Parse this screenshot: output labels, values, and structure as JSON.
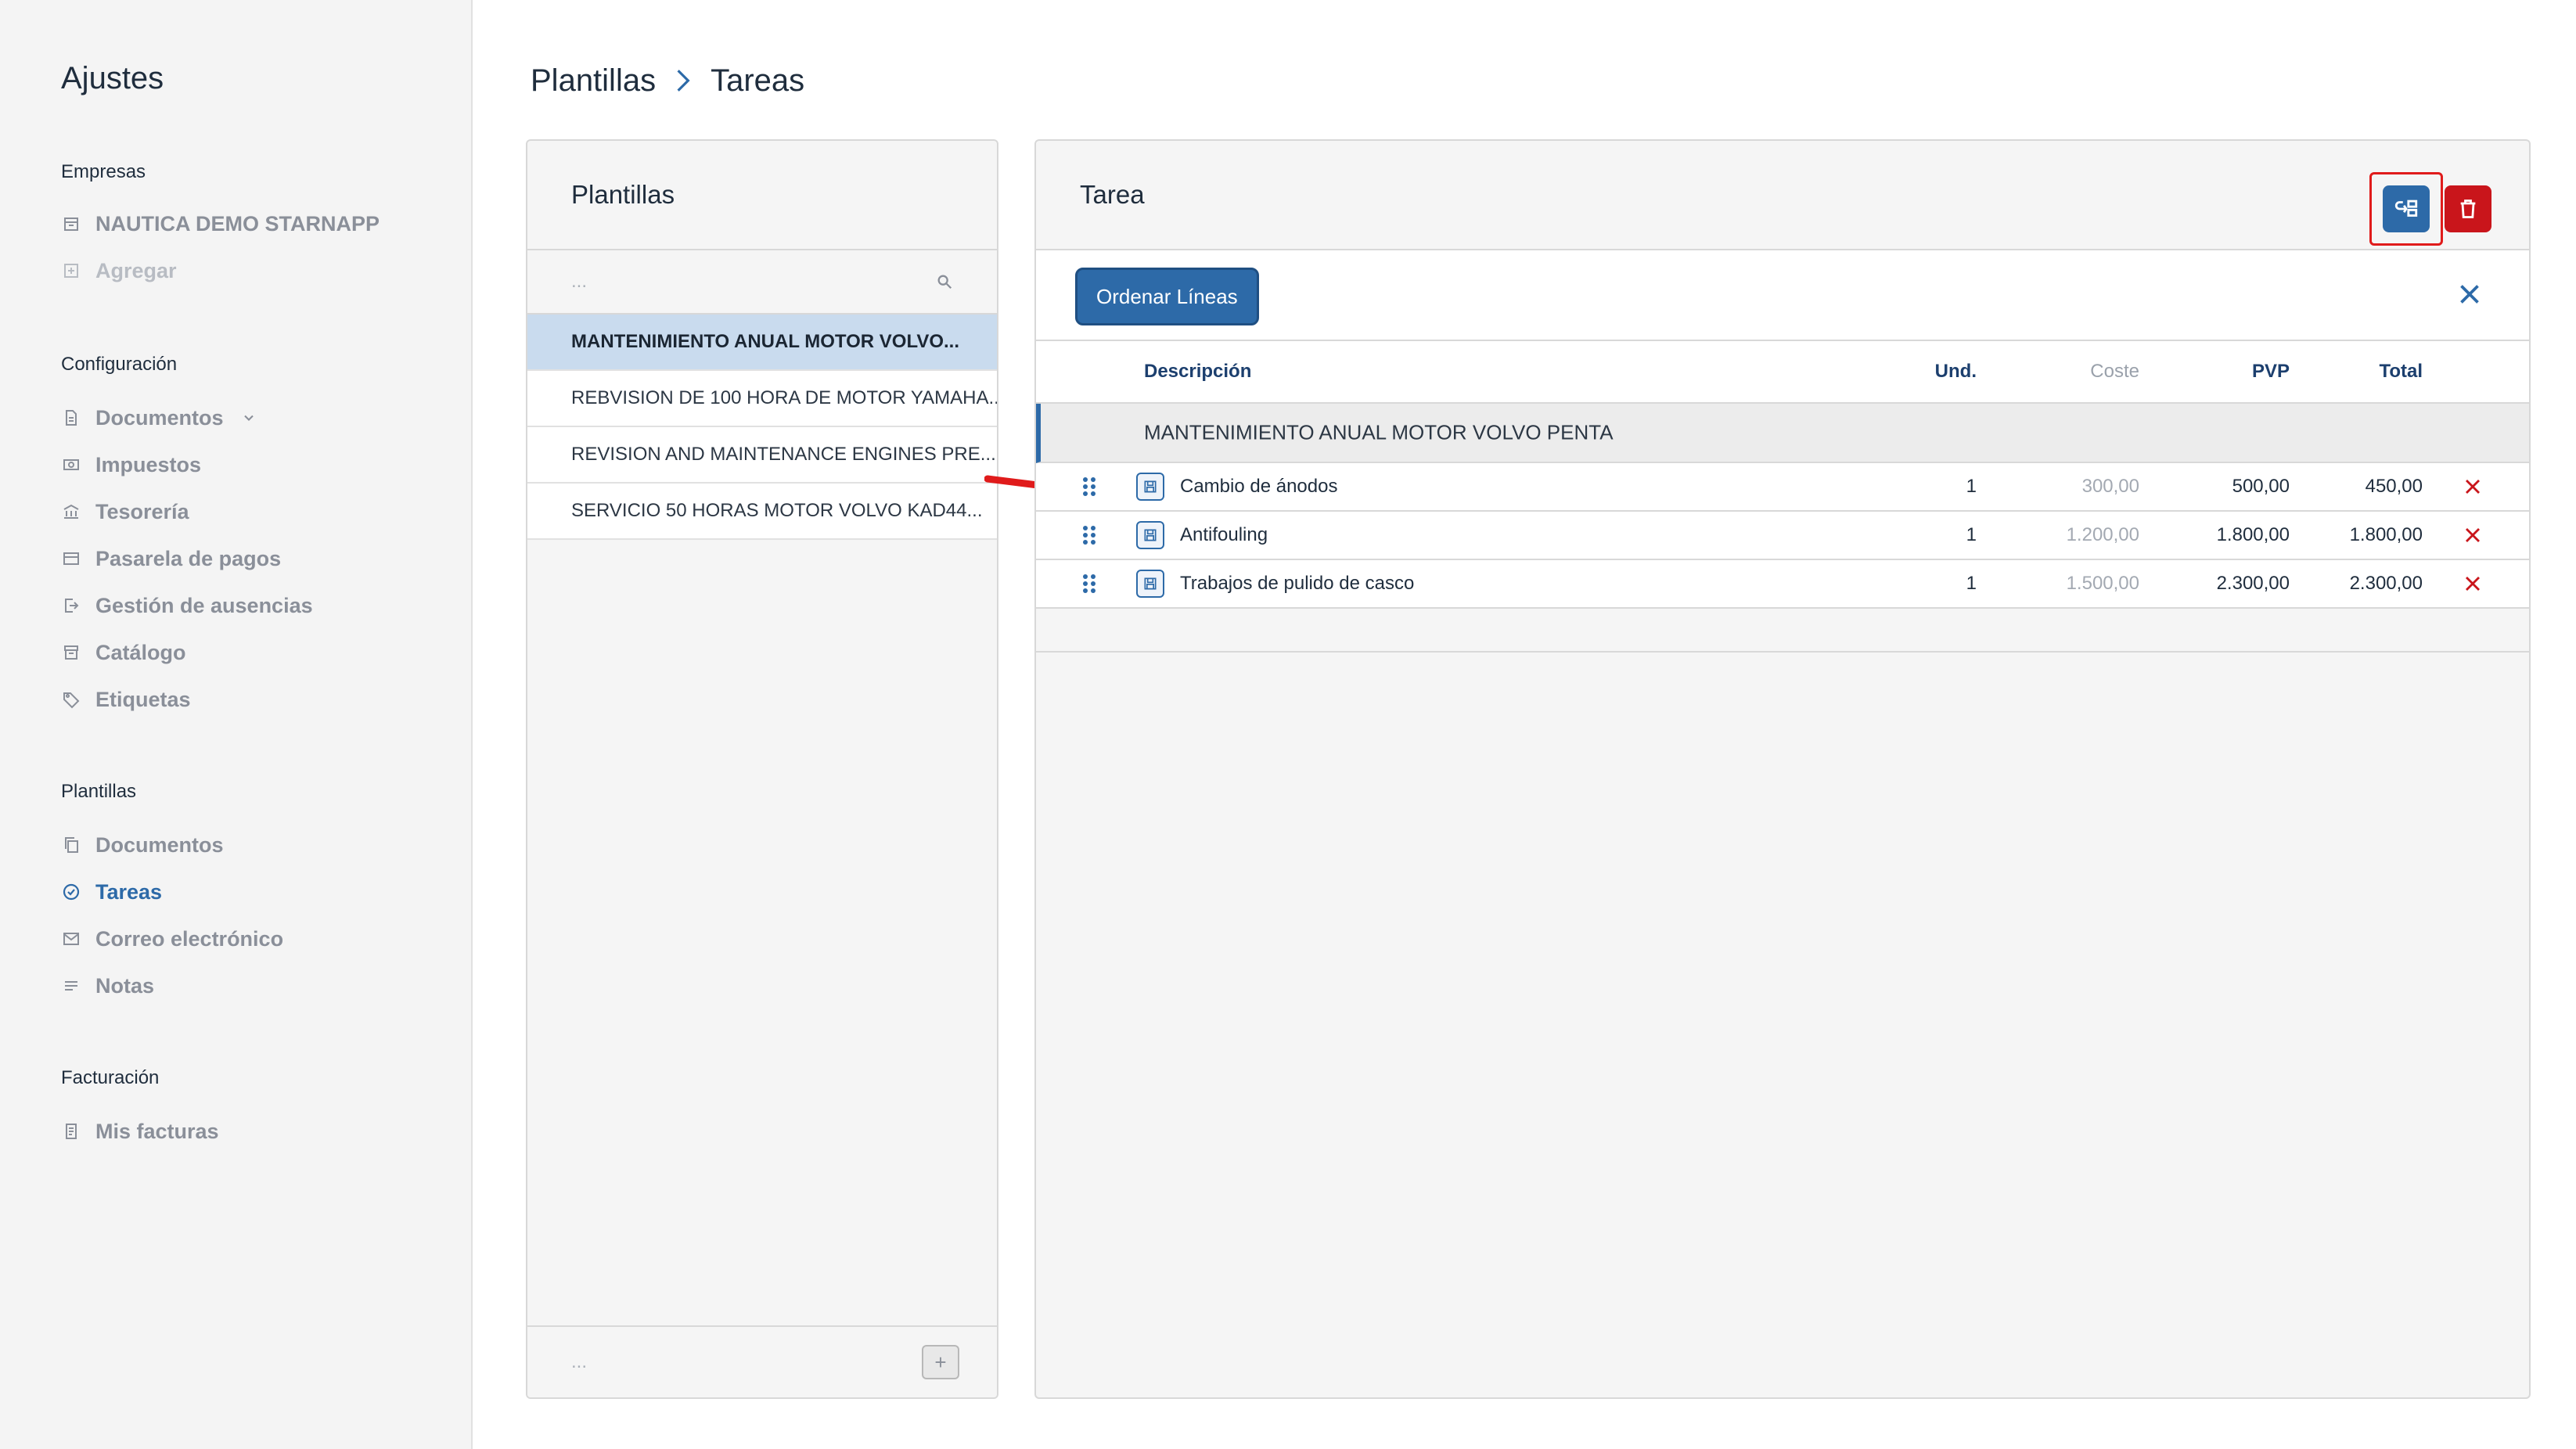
{
  "sidebar": {
    "title": "Ajustes",
    "sections": [
      {
        "label": "Empresas"
      },
      {
        "label": "Configuración"
      },
      {
        "label": "Plantillas"
      },
      {
        "label": "Facturación"
      }
    ],
    "items": {
      "empresa": {
        "label": "NAUTICA DEMO STARNAPP",
        "icon": "building-icon"
      },
      "agregar": {
        "label": "Agregar",
        "icon": "plus-square-icon"
      },
      "documentos": {
        "label": "Documentos",
        "icon": "document-icon"
      },
      "impuestos": {
        "label": "Impuestos",
        "icon": "money-icon"
      },
      "tesoreria": {
        "label": "Tesorería",
        "icon": "bank-icon"
      },
      "pasarela": {
        "label": "Pasarela de pagos",
        "icon": "card-icon"
      },
      "ausencias": {
        "label": "Gestión de ausencias",
        "icon": "exit-icon"
      },
      "catalogo": {
        "label": "Catálogo",
        "icon": "archive-icon"
      },
      "etiquetas": {
        "label": "Etiquetas",
        "icon": "tag-icon"
      },
      "pl_documentos": {
        "label": "Documentos",
        "icon": "copy-icon"
      },
      "pl_tareas": {
        "label": "Tareas",
        "icon": "check-circle-icon"
      },
      "pl_correo": {
        "label": "Correo electrónico",
        "icon": "mail-icon"
      },
      "pl_notas": {
        "label": "Notas",
        "icon": "lines-icon"
      },
      "facturas": {
        "label": "Mis facturas",
        "icon": "invoice-icon"
      }
    }
  },
  "breadcrumb": {
    "parent": "Plantillas",
    "current": "Tareas"
  },
  "templates_panel": {
    "title": "Plantillas",
    "search_placeholder": "...",
    "items": [
      "MANTENIMIENTO ANUAL MOTOR VOLVO...",
      "REBVISION DE 100 HORA DE MOTOR YAMAHA...",
      "REVISION AND MAINTENANCE ENGINES PRE...",
      "SERVICIO 50 HORAS MOTOR VOLVO KAD44..."
    ],
    "footer_text": "...",
    "add_label": "+"
  },
  "task_panel": {
    "title": "Tarea",
    "order_button": "Ordenar Líneas",
    "columns": {
      "descripcion": "Descripción",
      "und": "Und.",
      "coste": "Coste",
      "pvp": "PVP",
      "total": "Total"
    },
    "group_title": "MANTENIMIENTO ANUAL MOTOR VOLVO PENTA",
    "rows": [
      {
        "descripcion": "Cambio de ánodos",
        "und": "1",
        "coste": "300,00",
        "pvp": "500,00",
        "total": "450,00"
      },
      {
        "descripcion": "Antifouling",
        "und": "1",
        "coste": "1.200,00",
        "pvp": "1.800,00",
        "total": "1.800,00"
      },
      {
        "descripcion": "Trabajos de pulido de casco",
        "und": "1",
        "coste": "1.500,00",
        "pvp": "2.300,00",
        "total": "2.300,00"
      }
    ]
  },
  "colors": {
    "accent": "#2d6aa8",
    "danger": "#c9151b",
    "highlight": "#e01b1b",
    "selected_row": "#c9dbee"
  }
}
